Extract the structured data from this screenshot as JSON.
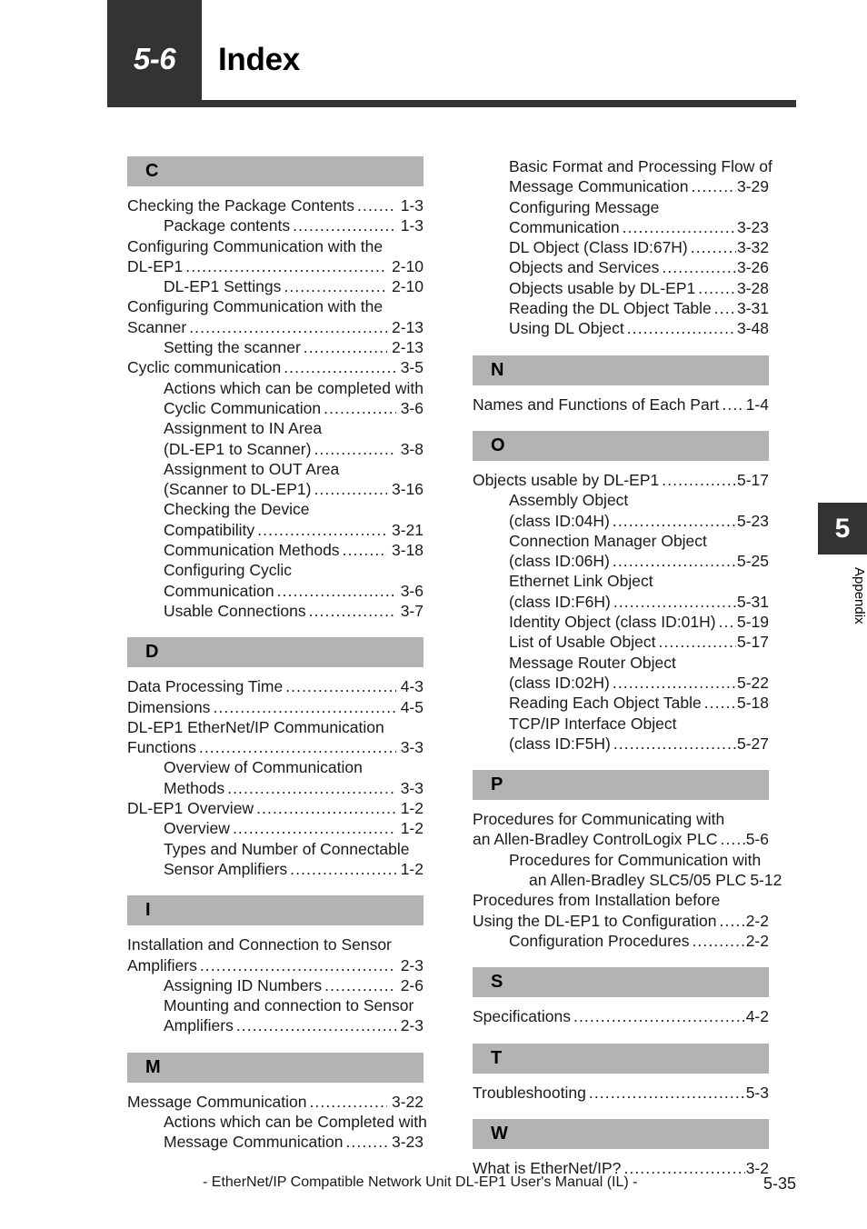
{
  "header": {
    "chapter_number": "5-6",
    "title": "Index"
  },
  "side_tab": {
    "number": "5",
    "label": "Appendix"
  },
  "footer": {
    "manual_title": "- EtherNet/IP Compatible Network Unit DL-EP1 User's Manual (IL) -",
    "page_number": "5-35"
  },
  "columns": {
    "left": [
      {
        "letter": "C",
        "entries": [
          {
            "level": 1,
            "text": "Checking the Package Contents",
            "page": "1-3"
          },
          {
            "level": 2,
            "text": "Package contents",
            "page": "1-3"
          },
          {
            "level": 1,
            "text": "Configuring Communication with the",
            "page": ""
          },
          {
            "level": 1,
            "text": "DL-EP1",
            "page": "2-10"
          },
          {
            "level": 2,
            "text": "DL-EP1 Settings",
            "page": "2-10"
          },
          {
            "level": 1,
            "text": "Configuring Communication with the",
            "page": ""
          },
          {
            "level": 1,
            "text": "Scanner",
            "page": "2-13"
          },
          {
            "level": 2,
            "text": "Setting the scanner",
            "page": "2-13"
          },
          {
            "level": 1,
            "text": "Cyclic communication",
            "page": "3-5"
          },
          {
            "level": 2,
            "text": "Actions which can be completed with",
            "page": ""
          },
          {
            "level": 2,
            "text": "Cyclic Communication",
            "page": "3-6"
          },
          {
            "level": 2,
            "text": "Assignment to IN Area",
            "page": ""
          },
          {
            "level": 2,
            "text": "(DL-EP1 to Scanner)",
            "page": "3-8"
          },
          {
            "level": 2,
            "text": "Assignment to OUT Area",
            "page": ""
          },
          {
            "level": 2,
            "text": "(Scanner to DL-EP1)",
            "page": "3-16"
          },
          {
            "level": 2,
            "text": "Checking the Device",
            "page": ""
          },
          {
            "level": 2,
            "text": "Compatibility",
            "page": "3-21"
          },
          {
            "level": 2,
            "text": "Communication Methods",
            "page": "3-18"
          },
          {
            "level": 2,
            "text": "Configuring Cyclic",
            "page": ""
          },
          {
            "level": 2,
            "text": "Communication",
            "page": "3-6"
          },
          {
            "level": 2,
            "text": "Usable Connections",
            "page": "3-7"
          }
        ]
      },
      {
        "letter": "D",
        "entries": [
          {
            "level": 1,
            "text": "Data Processing Time",
            "page": "4-3"
          },
          {
            "level": 1,
            "text": "Dimensions",
            "page": "4-5"
          },
          {
            "level": 1,
            "text": "DL-EP1 EtherNet/IP Communication",
            "page": ""
          },
          {
            "level": 1,
            "text": "Functions",
            "page": "3-3"
          },
          {
            "level": 2,
            "text": "Overview of Communication",
            "page": ""
          },
          {
            "level": 2,
            "text": "Methods",
            "page": "3-3"
          },
          {
            "level": 1,
            "text": "DL-EP1 Overview",
            "page": "1-2"
          },
          {
            "level": 2,
            "text": "Overview",
            "page": "1-2"
          },
          {
            "level": 2,
            "text": "Types and Number of Connectable",
            "page": ""
          },
          {
            "level": 2,
            "text": "Sensor Amplifiers",
            "page": "1-2"
          }
        ]
      },
      {
        "letter": "I",
        "entries": [
          {
            "level": 1,
            "text": "Installation and Connection to Sensor",
            "page": ""
          },
          {
            "level": 1,
            "text": "Amplifiers",
            "page": "2-3"
          },
          {
            "level": 2,
            "text": "Assigning ID Numbers",
            "page": "2-6"
          },
          {
            "level": 2,
            "text": "Mounting and connection to Sensor",
            "page": ""
          },
          {
            "level": 2,
            "text": "Amplifiers",
            "page": "2-3"
          }
        ]
      },
      {
        "letter": "M",
        "entries": [
          {
            "level": 1,
            "text": "Message Communication",
            "page": "3-22"
          },
          {
            "level": 2,
            "text": "Actions which can be Completed with",
            "page": ""
          },
          {
            "level": 2,
            "text": "Message Communication",
            "page": "3-23"
          }
        ]
      }
    ],
    "right": [
      {
        "letter": "",
        "entries": [
          {
            "level": 2,
            "text": "Basic Format and Processing Flow of",
            "page": ""
          },
          {
            "level": 2,
            "text": "Message Communication",
            "page": "3-29"
          },
          {
            "level": 2,
            "text": "Configuring Message",
            "page": ""
          },
          {
            "level": 2,
            "text": "Communication",
            "page": "3-23"
          },
          {
            "level": 2,
            "text": "DL Object (Class ID:67H)",
            "page": "3-32"
          },
          {
            "level": 2,
            "text": "Objects and Services",
            "page": "3-26"
          },
          {
            "level": 2,
            "text": "Objects usable by DL-EP1",
            "page": "3-28"
          },
          {
            "level": 2,
            "text": "Reading the DL Object Table",
            "page": "3-31"
          },
          {
            "level": 2,
            "text": "Using DL Object",
            "page": "3-48"
          }
        ]
      },
      {
        "letter": "N",
        "entries": [
          {
            "level": 1,
            "text": "Names and Functions of Each Part",
            "page": "1-4"
          }
        ]
      },
      {
        "letter": "O",
        "entries": [
          {
            "level": 1,
            "text": "Objects usable by DL-EP1",
            "page": "5-17"
          },
          {
            "level": 2,
            "text": "Assembly Object",
            "page": ""
          },
          {
            "level": 2,
            "text": "(class ID:04H)",
            "page": "5-23"
          },
          {
            "level": 2,
            "text": "Connection Manager Object",
            "page": ""
          },
          {
            "level": 2,
            "text": "(class ID:06H)",
            "page": "5-25"
          },
          {
            "level": 2,
            "text": "Ethernet Link Object",
            "page": ""
          },
          {
            "level": 2,
            "text": "(class ID:F6H)",
            "page": "5-31"
          },
          {
            "level": 2,
            "text": "Identity Object (class ID:01H)",
            "page": "5-19"
          },
          {
            "level": 2,
            "text": "List of Usable Object",
            "page": "5-17"
          },
          {
            "level": 2,
            "text": "Message Router Object",
            "page": ""
          },
          {
            "level": 2,
            "text": "(class ID:02H)",
            "page": "5-22"
          },
          {
            "level": 2,
            "text": "Reading Each Object Table",
            "page": "5-18"
          },
          {
            "level": 2,
            "text": "TCP/IP Interface Object",
            "page": ""
          },
          {
            "level": 2,
            "text": "(class ID:F5H)",
            "page": "5-27"
          }
        ]
      },
      {
        "letter": "P",
        "entries": [
          {
            "level": 1,
            "text": "Procedures for Communicating with",
            "page": ""
          },
          {
            "level": 1,
            "text": "an Allen-Bradley ControlLogix PLC",
            "page": "5-6"
          },
          {
            "level": 2,
            "text": "Procedures for Communication with",
            "page": ""
          },
          {
            "level": 3,
            "text": "an Allen-Bradley SLC5/05 PLC",
            "page": "5-12"
          },
          {
            "level": 1,
            "text": "Procedures from Installation before",
            "page": ""
          },
          {
            "level": 1,
            "text": "Using the DL-EP1 to Configuration",
            "page": "2-2"
          },
          {
            "level": 2,
            "text": "Configuration Procedures",
            "page": "2-2"
          }
        ]
      },
      {
        "letter": "S",
        "entries": [
          {
            "level": 1,
            "text": "Specifications",
            "page": "4-2"
          }
        ]
      },
      {
        "letter": "T",
        "entries": [
          {
            "level": 1,
            "text": "Troubleshooting",
            "page": "5-3"
          }
        ]
      },
      {
        "letter": "W",
        "entries": [
          {
            "level": 1,
            "text": "What is EtherNet/IP?",
            "page": "3-2"
          }
        ]
      }
    ]
  }
}
